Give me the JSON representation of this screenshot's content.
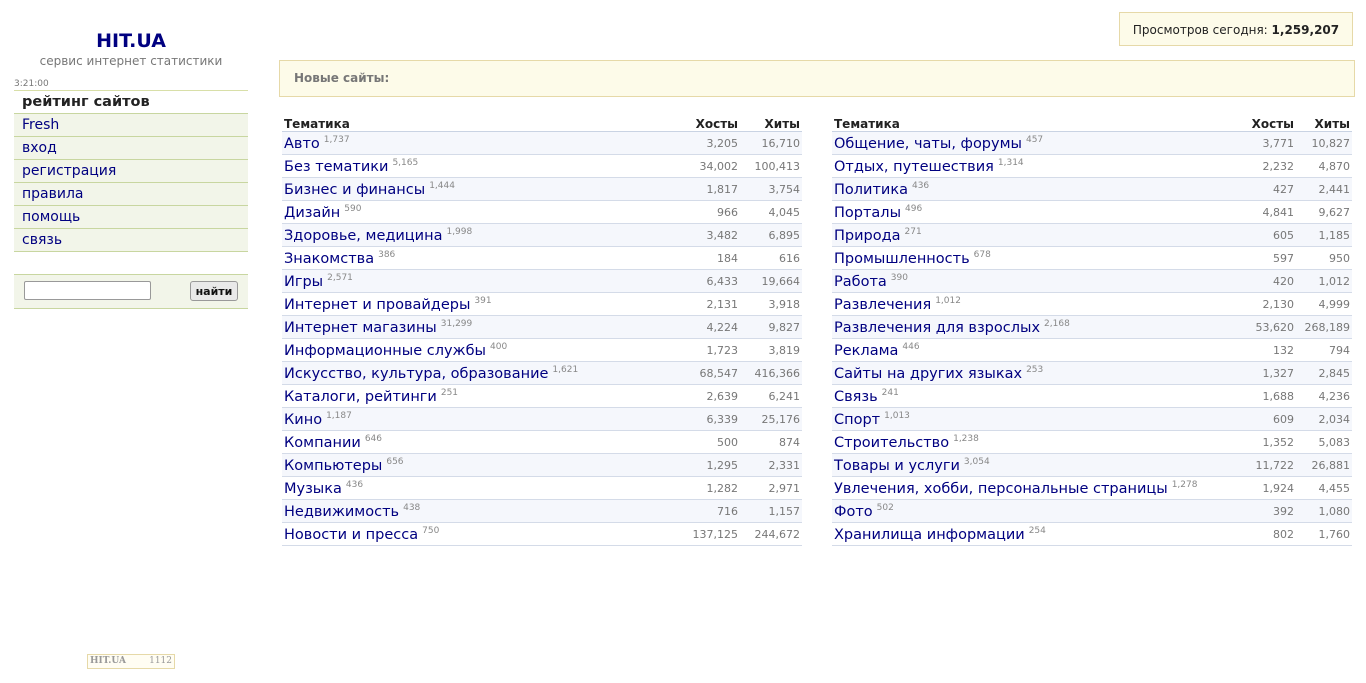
{
  "site": {
    "logo": "HIT.UA",
    "tagline": "сервис интернет статистики",
    "time": "3:21:00"
  },
  "menu": [
    {
      "label": "рейтинг сайтов",
      "active": true
    },
    {
      "label": "Fresh"
    },
    {
      "label": "вход"
    },
    {
      "label": "регистрация"
    },
    {
      "label": "правила"
    },
    {
      "label": "помощь"
    },
    {
      "label": "связь"
    }
  ],
  "search": {
    "value": "",
    "button_label": "найти"
  },
  "counter": {
    "brand": "HIT.UA",
    "value": "1112"
  },
  "views": {
    "label": "Просмотров сегодня:",
    "value": "1,259,207"
  },
  "new_sites": {
    "label": "Новые сайты:"
  },
  "table_headers": {
    "topic": "Тематика",
    "hosts": "Хосты",
    "hits": "Хиты"
  },
  "left_table": [
    {
      "name": "Авто",
      "count": "1,737",
      "hosts": "3,205",
      "hits": "16,710"
    },
    {
      "name": "Без тематики",
      "count": "5,165",
      "hosts": "34,002",
      "hits": "100,413"
    },
    {
      "name": "Бизнес и финансы",
      "count": "1,444",
      "hosts": "1,817",
      "hits": "3,754"
    },
    {
      "name": "Дизайн",
      "count": "590",
      "hosts": "966",
      "hits": "4,045"
    },
    {
      "name": "Здоровье, медицина",
      "count": "1,998",
      "hosts": "3,482",
      "hits": "6,895"
    },
    {
      "name": "Знакомства",
      "count": "386",
      "hosts": "184",
      "hits": "616"
    },
    {
      "name": "Игры",
      "count": "2,571",
      "hosts": "6,433",
      "hits": "19,664"
    },
    {
      "name": "Интернет и провайдеры",
      "count": "391",
      "hosts": "2,131",
      "hits": "3,918"
    },
    {
      "name": "Интернет магазины",
      "count": "31,299",
      "hosts": "4,224",
      "hits": "9,827"
    },
    {
      "name": "Информационные службы",
      "count": "400",
      "hosts": "1,723",
      "hits": "3,819"
    },
    {
      "name": "Искусство, культура, образование",
      "count": "1,621",
      "hosts": "68,547",
      "hits": "416,366"
    },
    {
      "name": "Каталоги, рейтинги",
      "count": "251",
      "hosts": "2,639",
      "hits": "6,241"
    },
    {
      "name": "Кино",
      "count": "1,187",
      "hosts": "6,339",
      "hits": "25,176"
    },
    {
      "name": "Компании",
      "count": "646",
      "hosts": "500",
      "hits": "874"
    },
    {
      "name": "Компьютеры",
      "count": "656",
      "hosts": "1,295",
      "hits": "2,331"
    },
    {
      "name": "Музыка",
      "count": "436",
      "hosts": "1,282",
      "hits": "2,971"
    },
    {
      "name": "Недвижимость",
      "count": "438",
      "hosts": "716",
      "hits": "1,157"
    },
    {
      "name": "Новости и пресса",
      "count": "750",
      "hosts": "137,125",
      "hits": "244,672"
    }
  ],
  "right_table": [
    {
      "name": "Общение, чаты, форумы",
      "count": "457",
      "hosts": "3,771",
      "hits": "10,827"
    },
    {
      "name": "Отдых, путешествия",
      "count": "1,314",
      "hosts": "2,232",
      "hits": "4,870"
    },
    {
      "name": "Политика",
      "count": "436",
      "hosts": "427",
      "hits": "2,441"
    },
    {
      "name": "Порталы",
      "count": "496",
      "hosts": "4,841",
      "hits": "9,627"
    },
    {
      "name": "Природа",
      "count": "271",
      "hosts": "605",
      "hits": "1,185"
    },
    {
      "name": "Промышленность",
      "count": "678",
      "hosts": "597",
      "hits": "950"
    },
    {
      "name": "Работа",
      "count": "390",
      "hosts": "420",
      "hits": "1,012"
    },
    {
      "name": "Развлечения",
      "count": "1,012",
      "hosts": "2,130",
      "hits": "4,999"
    },
    {
      "name": "Развлечения для взрослых",
      "count": "2,168",
      "hosts": "53,620",
      "hits": "268,189"
    },
    {
      "name": "Реклама",
      "count": "446",
      "hosts": "132",
      "hits": "794"
    },
    {
      "name": "Сайты на других языках",
      "count": "253",
      "hosts": "1,327",
      "hits": "2,845"
    },
    {
      "name": "Связь",
      "count": "241",
      "hosts": "1,688",
      "hits": "4,236"
    },
    {
      "name": "Спорт",
      "count": "1,013",
      "hosts": "609",
      "hits": "2,034"
    },
    {
      "name": "Строительство",
      "count": "1,238",
      "hosts": "1,352",
      "hits": "5,083"
    },
    {
      "name": "Товары и услуги",
      "count": "3,054",
      "hosts": "11,722",
      "hits": "26,881"
    },
    {
      "name": "Увлечения, хобби, персональные страницы",
      "count": "1,278",
      "hosts": "1,924",
      "hits": "4,455"
    },
    {
      "name": "Фото",
      "count": "502",
      "hosts": "392",
      "hits": "1,080"
    },
    {
      "name": "Хранилища информации",
      "count": "254",
      "hosts": "802",
      "hits": "1,760"
    }
  ]
}
